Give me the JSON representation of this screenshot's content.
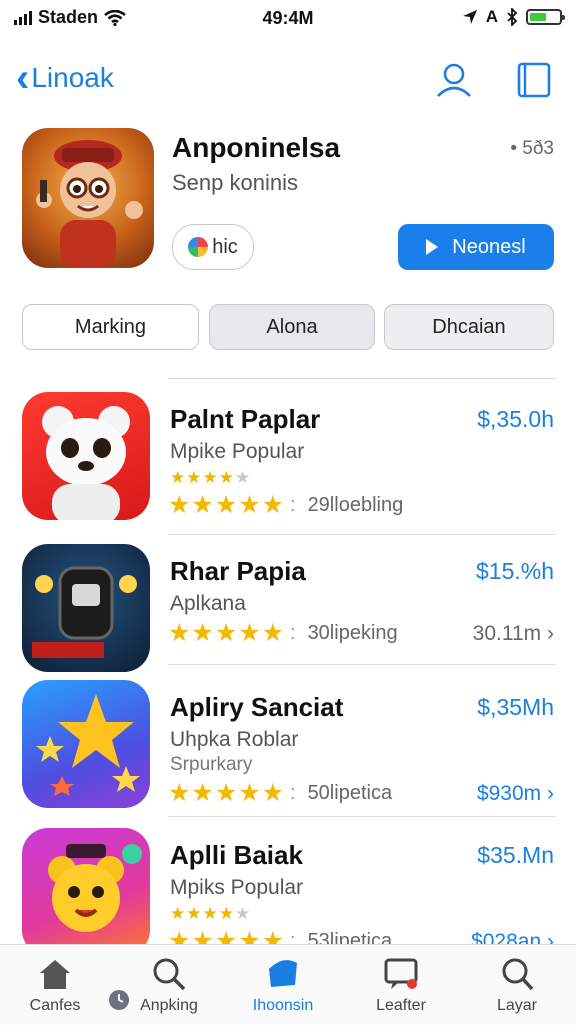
{
  "status": {
    "carrier": "Staden",
    "time": "49:4M",
    "right_text": "A"
  },
  "nav": {
    "back_label": "Linoak"
  },
  "hero": {
    "title": "Anponinelsa",
    "subtitle": "Senp koninis",
    "meta": "• 5ð3",
    "pill_label": "hic",
    "get_label": "Neonesl"
  },
  "segments": [
    "Marking",
    "Alona",
    "Dhcaian"
  ],
  "apps": [
    {
      "title": "Palnt Paplar",
      "subtitle": "Mpike Popular",
      "subtitle2": "",
      "price": "$,35.0h",
      "count": "29lloebling",
      "meta": "",
      "mini_stars": 4
    },
    {
      "title": "Rhar Papia",
      "subtitle": "Aplkana",
      "subtitle2": "",
      "price": "$15.%h",
      "count": "30lipeking",
      "meta": "30.11m",
      "mini_stars": 0
    },
    {
      "title": "Apliry Sanciat",
      "subtitle": "Uhpka Roblar",
      "subtitle2": "Srpurkary",
      "price": "$,35Mh",
      "count": "50lipetica",
      "meta": "$930m",
      "mini_stars": 0
    },
    {
      "title": "Aplli Baiak",
      "subtitle": "Mpiks Popular",
      "subtitle2": "",
      "price": "$35.Mn",
      "count": "53lipetica",
      "meta": "$028an",
      "mini_stars": 4
    }
  ],
  "tabs": [
    "Canfes",
    "Anpking",
    "Ihoonsin",
    "Leafter",
    "Layar"
  ],
  "colors": {
    "accent": "#1a7fe0",
    "star": "#f5b800"
  }
}
